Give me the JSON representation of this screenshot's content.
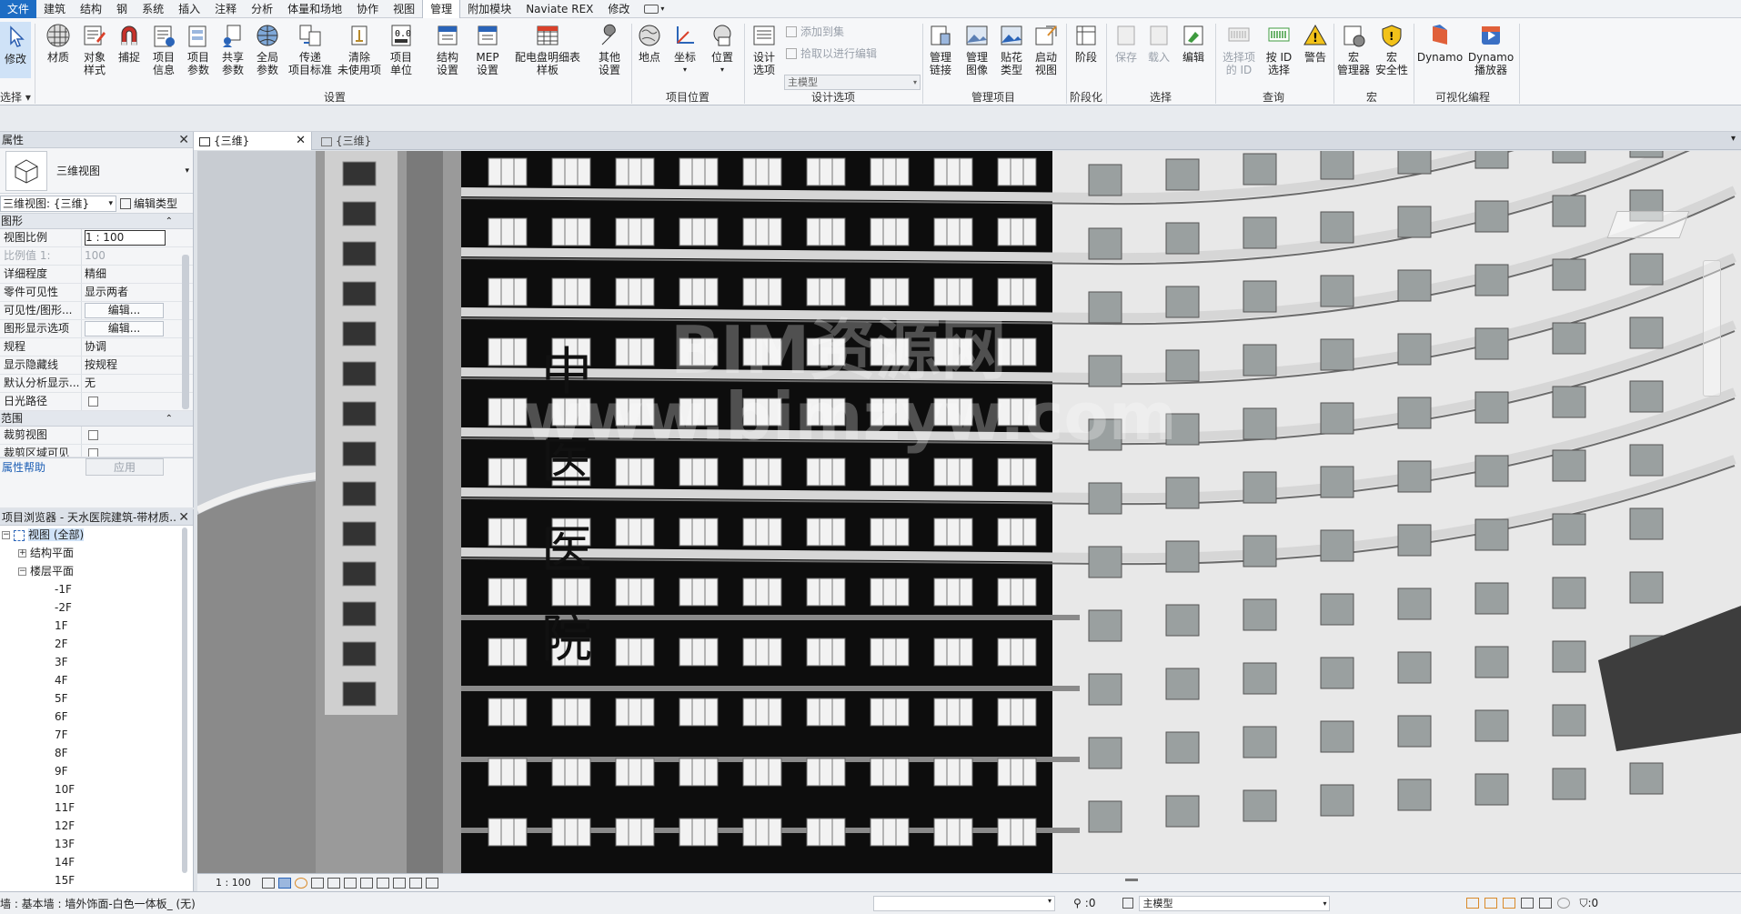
{
  "menu": {
    "tabs": [
      "文件",
      "建筑",
      "结构",
      "钢",
      "系统",
      "插入",
      "注释",
      "分析",
      "体量和场地",
      "协作",
      "视图",
      "管理",
      "附加模块",
      "Naviate REX",
      "修改"
    ],
    "active": "管理"
  },
  "ribbon": {
    "modify": "修改",
    "select_panel": "选择",
    "buttons": {
      "materials": "材质",
      "object_styles": [
        "对象",
        "样式"
      ],
      "snaps": "捕捉",
      "project_info": [
        "项目",
        "信息"
      ],
      "project_params": [
        "项目",
        "参数"
      ],
      "shared_params": [
        "共享",
        "参数"
      ],
      "global_params": [
        "全局",
        "参数"
      ],
      "transfer_standards": [
        "传递",
        "项目标准"
      ],
      "purge_unused": [
        "清除",
        "未使用项"
      ],
      "project_units": [
        "项目",
        "单位"
      ],
      "structural_settings": [
        "结构",
        "设置"
      ],
      "mep_settings": [
        "MEP",
        "设置"
      ],
      "panel_schedule": [
        "配电盘明细表",
        "样板"
      ],
      "other_settings": [
        "其他",
        "设置"
      ],
      "location": "地点",
      "coordinates": "坐标",
      "position": "位置",
      "design_options": [
        "设计",
        "选项"
      ],
      "add_to_set": "添加到集",
      "pick_to_edit": "拾取以进行编辑",
      "main_model": "主模型",
      "manage_links": [
        "管理",
        "链接"
      ],
      "manage_images": [
        "管理",
        "图像"
      ],
      "decal_types": [
        "贴花",
        "类型"
      ],
      "starting_view": [
        "启动",
        "视图"
      ],
      "phases": "阶段",
      "save_sel": "保存",
      "load_sel": "载入",
      "edit_sel": "编辑",
      "ids_of_sel": [
        "选择项",
        "的 ID"
      ],
      "select_by_id": [
        "按 ID",
        "选择"
      ],
      "warnings": "警告",
      "macro_manager": [
        "宏",
        "管理器"
      ],
      "macro_security": [
        "宏",
        "安全性"
      ],
      "dynamo": "Dynamo",
      "dynamo_player": [
        "Dynamo",
        "播放器"
      ]
    },
    "panels": {
      "settings": "设置",
      "project_location": "项目位置",
      "design_options": "设计选项",
      "manage_project": "管理项目",
      "phasing": "阶段化",
      "selection": "选择",
      "inquiry": "查询",
      "macros": "宏",
      "visual_programming": "可视化编程"
    }
  },
  "properties": {
    "title": "属性",
    "type_name": "三维视图",
    "filter": "三维视图: {三维}",
    "edit_type": "编辑类型",
    "group_graphics": "图形",
    "group_extents": "范围",
    "rows": [
      {
        "k": "视图比例",
        "v": "1 : 100"
      },
      {
        "k": "比例值 1:",
        "v": "100"
      },
      {
        "k": "详细程度",
        "v": "精细"
      },
      {
        "k": "零件可见性",
        "v": "显示两者"
      },
      {
        "k": "可见性/图形...",
        "v": "编辑..."
      },
      {
        "k": "图形显示选项",
        "v": "编辑..."
      },
      {
        "k": "规程",
        "v": "协调"
      },
      {
        "k": "显示隐藏线",
        "v": "按规程"
      },
      {
        "k": "默认分析显示...",
        "v": "无"
      },
      {
        "k": "日光路径",
        "v": ""
      }
    ],
    "extent_rows": [
      {
        "k": "裁剪视图",
        "v": ""
      },
      {
        "k": "裁剪区域可见",
        "v": ""
      }
    ],
    "help": "属性帮助",
    "apply": "应用"
  },
  "browser": {
    "title": "项目浏览器 - 天水医院建筑-带材质...",
    "root": "视图 (全部)",
    "structural_plans": "结构平面",
    "floor_plans": "楼层平面",
    "levels": [
      "-1F",
      "-2F",
      "1F",
      "2F",
      "3F",
      "4F",
      "5F",
      "6F",
      "7F",
      "8F",
      "9F",
      "10F",
      "11F",
      "12F",
      "13F",
      "14F",
      "15F"
    ]
  },
  "view_tabs": {
    "active": "{三维}",
    "inactive": "{三维}"
  },
  "canvas": {
    "sign": [
      "中",
      "医",
      "医",
      "院"
    ],
    "watermark_1": "BIM资源网",
    "watermark_2": "www.bimzyw.com"
  },
  "viewbar": {
    "scale": "1 : 100"
  },
  "status": {
    "message": "墙 : 基本墙 : 墙外饰面-白色一体板_ (无)",
    "count": ":0",
    "model": "主模型",
    "filter_count": ":0"
  }
}
